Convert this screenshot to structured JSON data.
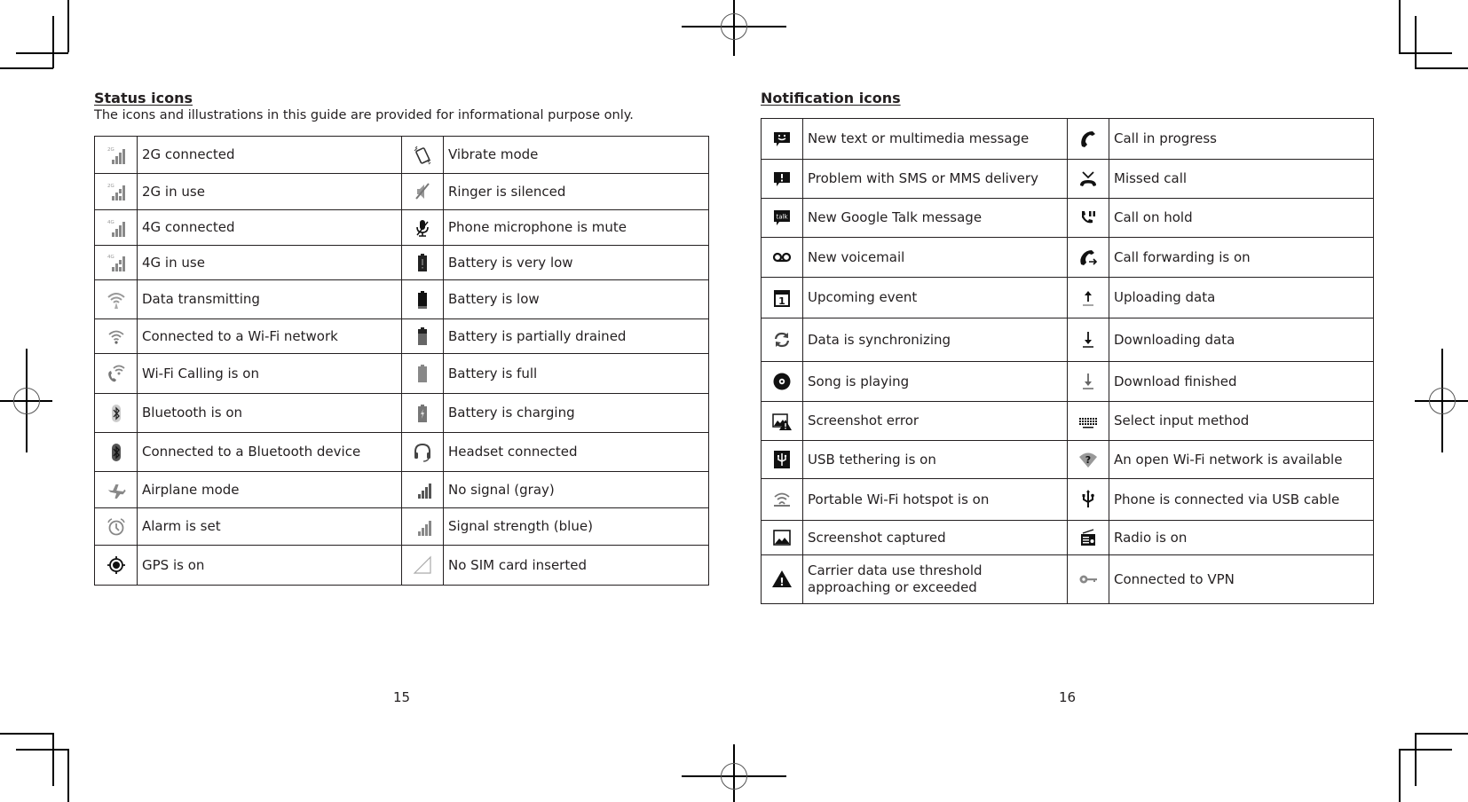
{
  "left_page": {
    "title": "Status icons",
    "subtitle": "The icons and illustrations in this guide are provided for informational purpose only.",
    "page_number": "15",
    "rows": [
      {
        "left": {
          "icon": "signal-2g-icon",
          "label": "2G connected"
        },
        "right": {
          "icon": "vibrate-icon",
          "label": "Vibrate mode"
        }
      },
      {
        "left": {
          "icon": "signal-2g-in-use-icon",
          "label": "2G in use"
        },
        "right": {
          "icon": "ringer-silenced-icon",
          "label": "Ringer is silenced"
        }
      },
      {
        "left": {
          "icon": "signal-4g-icon",
          "label": "4G connected"
        },
        "right": {
          "icon": "mic-mute-icon",
          "label": "Phone microphone is mute"
        }
      },
      {
        "left": {
          "icon": "signal-4g-in-use-icon",
          "label": "4G in use"
        },
        "right": {
          "icon": "battery-very-low-icon",
          "label": "Battery is very low"
        }
      },
      {
        "left": {
          "icon": "wifi-data-icon",
          "label": "Data transmitting"
        },
        "right": {
          "icon": "battery-low-icon",
          "label": "Battery is low"
        }
      },
      {
        "left": {
          "icon": "wifi-icon",
          "label": "Connected to a Wi-Fi network"
        },
        "right": {
          "icon": "battery-partial-icon",
          "label": "Battery is partially drained"
        }
      },
      {
        "left": {
          "icon": "wifi-calling-icon",
          "label": "Wi-Fi Calling is on"
        },
        "right": {
          "icon": "battery-full-icon",
          "label": "Battery is full"
        }
      },
      {
        "left": {
          "icon": "bluetooth-icon",
          "label": "Bluetooth is on"
        },
        "right": {
          "icon": "battery-charging-icon",
          "label": "Battery is charging"
        }
      },
      {
        "left": {
          "icon": "bluetooth-connected-icon",
          "label": "Connected to a Bluetooth device"
        },
        "right": {
          "icon": "headset-icon",
          "label": "Headset connected"
        }
      },
      {
        "left": {
          "icon": "airplane-icon",
          "label": "Airplane mode"
        },
        "right": {
          "icon": "no-signal-icon",
          "label": "No signal (gray)"
        }
      },
      {
        "left": {
          "icon": "alarm-icon",
          "label": "Alarm is set"
        },
        "right": {
          "icon": "signal-strength-icon",
          "label": "Signal strength (blue)"
        }
      },
      {
        "left": {
          "icon": "gps-icon",
          "label": "GPS is on"
        },
        "right": {
          "icon": "no-sim-icon",
          "label": "No SIM card inserted"
        }
      }
    ]
  },
  "right_page": {
    "title": "Notification icons",
    "page_number": "16",
    "rows": [
      {
        "left": {
          "icon": "sms-icon",
          "label": "New text or multimedia message"
        },
        "right": {
          "icon": "call-in-progress-icon",
          "label": "Call in progress"
        }
      },
      {
        "left": {
          "icon": "sms-error-icon",
          "label": "Problem with SMS or MMS delivery"
        },
        "right": {
          "icon": "missed-call-icon",
          "label": "Missed call"
        }
      },
      {
        "left": {
          "icon": "google-talk-icon",
          "label": "New Google Talk message",
          "glyph": "talk"
        },
        "right": {
          "icon": "call-hold-icon",
          "label": "Call on hold"
        }
      },
      {
        "left": {
          "icon": "voicemail-icon",
          "label": "New voicemail"
        },
        "right": {
          "icon": "call-forward-icon",
          "label": "Call forwarding is on"
        }
      },
      {
        "left": {
          "icon": "calendar-icon",
          "label": "Upcoming event",
          "glyph": "1"
        },
        "right": {
          "icon": "upload-icon",
          "label": "Uploading data"
        }
      },
      {
        "left": {
          "icon": "sync-icon",
          "label": "Data is synchronizing"
        },
        "right": {
          "icon": "download-icon",
          "label": "Downloading data"
        }
      },
      {
        "left": {
          "icon": "song-playing-icon",
          "label": "Song is playing"
        },
        "right": {
          "icon": "download-finished-icon",
          "label": "Download finished"
        }
      },
      {
        "left": {
          "icon": "screenshot-error-icon",
          "label": "Screenshot error"
        },
        "right": {
          "icon": "keyboard-icon",
          "label": "Select input method"
        }
      },
      {
        "left": {
          "icon": "usb-tethering-icon",
          "label": "USB tethering is on"
        },
        "right": {
          "icon": "open-wifi-icon",
          "label": "An open Wi-Fi network is available",
          "glyph": "?"
        }
      },
      {
        "left": {
          "icon": "hotspot-icon",
          "label": "Portable Wi-Fi hotspot is on"
        },
        "right": {
          "icon": "usb-icon",
          "label": "Phone is connected via USB cable"
        }
      },
      {
        "left": {
          "icon": "screenshot-icon",
          "label": "Screenshot captured"
        },
        "right": {
          "icon": "radio-icon",
          "label": "Radio is on"
        }
      },
      {
        "left": {
          "icon": "warning-icon",
          "label": "Carrier data use threshold approaching or exceeded",
          "glyph": "!"
        },
        "right": {
          "icon": "vpn-key-icon",
          "label": "Connected to VPN"
        }
      }
    ]
  }
}
